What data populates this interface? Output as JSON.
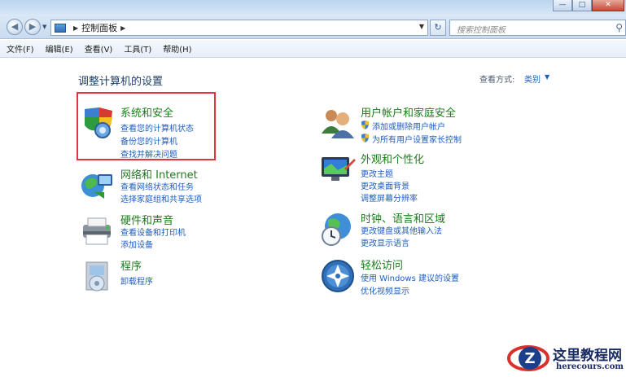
{
  "window": {
    "caption_buttons": [
      "—",
      "□",
      "✕"
    ]
  },
  "nav": {
    "back": "◀",
    "forward": "▶",
    "breadcrumb": [
      "控制面板"
    ],
    "search_placeholder": "搜索控制面板"
  },
  "menu": [
    "文件(F)",
    "编辑(E)",
    "查看(V)",
    "工具(T)",
    "帮助(H)"
  ],
  "main": {
    "title": "调整计算机的设置",
    "view_by_label": "查看方式:",
    "view_by_value": "类别"
  },
  "categories": [
    {
      "title": "系统和安全",
      "links": [
        "查看您的计算机状态",
        "备份您的计算机",
        "查找并解决问题"
      ]
    },
    {
      "title": "网络和 Internet",
      "links": [
        "查看网络状态和任务",
        "选择家庭组和共享选项"
      ]
    },
    {
      "title": "硬件和声音",
      "links": [
        "查看设备和打印机",
        "添加设备"
      ]
    },
    {
      "title": "程序",
      "links": [
        "卸载程序"
      ]
    },
    {
      "title": "用户帐户和家庭安全",
      "links": [
        "添加或删除用户帐户",
        "为所有用户设置家长控制"
      ]
    },
    {
      "title": "外观和个性化",
      "links": [
        "更改主题",
        "更改桌面背景",
        "调整屏幕分辨率"
      ]
    },
    {
      "title": "时钟、语言和区域",
      "links": [
        "更改键盘或其他输入法",
        "更改显示语言"
      ]
    },
    {
      "title": "轻松访问",
      "links": [
        "使用 Windows 建议的设置",
        "优化视频显示"
      ]
    }
  ],
  "watermark": {
    "cn": "这里教程网",
    "en": "herecours.com"
  },
  "colors": {
    "category_title": "#1c7d1c",
    "link": "#1e5ebf",
    "highlight_box": "#e3343a"
  }
}
